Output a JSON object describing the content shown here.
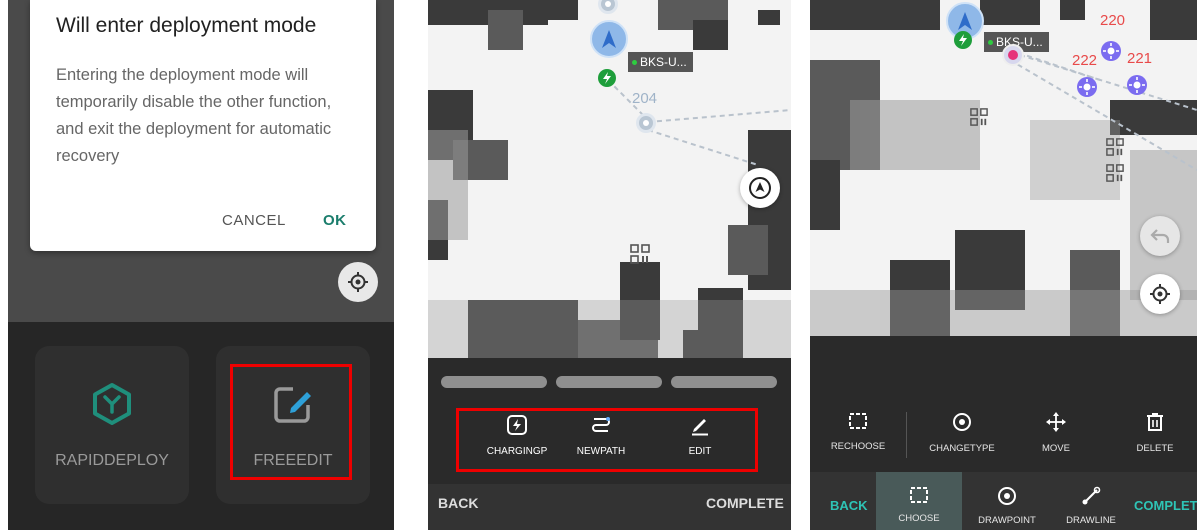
{
  "panel1": {
    "dialog": {
      "title": "Will enter deployment mode",
      "message": "Entering the deployment mode will temporarily disable the other function, and exit the deployment for automatic recovery",
      "cancel_label": "CANCEL",
      "ok_label": "OK"
    },
    "tiles": [
      {
        "label": "RAPIDDEPLOY",
        "icon": "rapid-deploy-hexagon-icon"
      },
      {
        "label": "FREEEDIT",
        "icon": "edit-pencil-icon"
      }
    ]
  },
  "panel2": {
    "robot_tag": "BKS-U...",
    "waypoint_number": "204",
    "tools": [
      {
        "label": "CHARGINGP",
        "icon": "charging-point-icon"
      },
      {
        "label": "NEWPATH",
        "icon": "new-path-icon"
      },
      {
        "label": "EDIT",
        "icon": "pencil-icon"
      }
    ],
    "back_label": "BACK",
    "complete_label": "COMPLETE"
  },
  "panel3": {
    "robot_tag": "BKS-U...",
    "point_numbers": [
      "220",
      "222",
      "221"
    ],
    "tools": [
      {
        "label": "RECHOOSE",
        "icon": "dashed-select-icon"
      },
      {
        "label": "CHANGETYPE",
        "icon": "target-circle-icon"
      },
      {
        "label": "MOVE",
        "icon": "move-arrows-icon"
      },
      {
        "label": "DELETE",
        "icon": "trash-icon"
      }
    ],
    "bottom_tools": [
      {
        "label": "CHOOSE",
        "icon": "dashed-select-icon"
      },
      {
        "label": "DRAWPOINT",
        "icon": "target-circle-icon"
      },
      {
        "label": "DRAWLINE",
        "icon": "draw-line-icon"
      }
    ],
    "back_label": "BACK",
    "complete_label": "COMPLETE"
  },
  "colors": {
    "accent_teal": "#2ec4b6",
    "highlight_red": "#ee0000",
    "charging_green": "#1e9e3b",
    "waypoint_purple": "#7b6cf0"
  }
}
